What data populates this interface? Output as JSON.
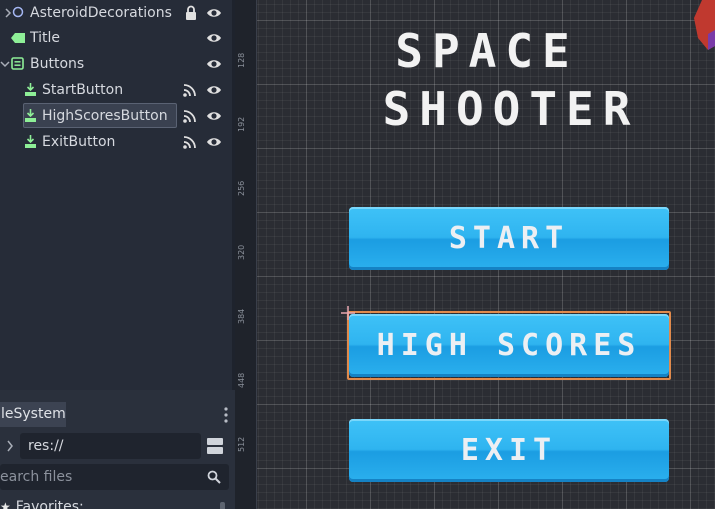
{
  "scene_tree": {
    "nodes": [
      {
        "label": "AsteroidDecorations",
        "icon": "node2d-circle-icon",
        "locked": true,
        "visible": true
      },
      {
        "label": "Title",
        "icon": "label-icon",
        "visible": true
      },
      {
        "label": "Buttons",
        "icon": "container-icon",
        "visible": true
      },
      {
        "label": "StartButton",
        "icon": "button-icon",
        "signals": true,
        "visible": true
      },
      {
        "label": "HighScoresButton",
        "icon": "button-icon",
        "signals": true,
        "visible": true,
        "selected": true
      },
      {
        "label": "ExitButton",
        "icon": "button-icon",
        "signals": true,
        "visible": true
      }
    ]
  },
  "filesystem": {
    "tab_label": "leSystem",
    "path": "res://",
    "search_placeholder": "earch files",
    "favorites_label": "Favorites:"
  },
  "ruler": {
    "labels": [
      "128",
      "192",
      "256",
      "320",
      "384",
      "448",
      "512"
    ]
  },
  "game": {
    "title_line1": "SPACE",
    "title_line2": "SHOOTER",
    "start_label": "START",
    "highscores_label": "HIGH SCORES",
    "exit_label": "EXIT"
  },
  "colors": {
    "button_blue": "#2fb4f0",
    "selection_orange": "#e08a4c",
    "panel_bg": "#262c38",
    "accent_green": "#8eef97"
  }
}
